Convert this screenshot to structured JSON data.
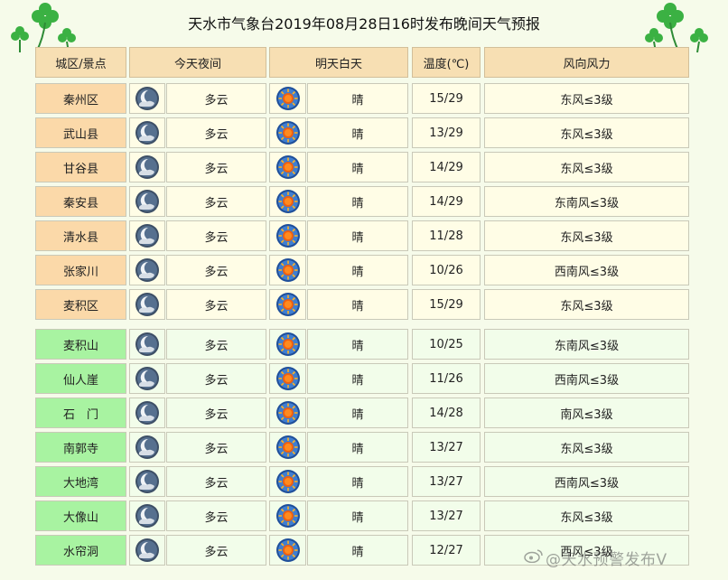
{
  "title": "天水市气象台2019年08月28日16时发布晚间天气预报",
  "headers": {
    "region": "城区/景点",
    "tonight": "今天夜间",
    "tomorrow": "明天白天",
    "temperature": "温度(℃)",
    "wind": "风向风力"
  },
  "icons": {
    "tonight": "cloudy-night-icon",
    "tomorrow": "sunny-icon"
  },
  "colors": {
    "header_bg": "#f7dfb3",
    "district_bg": "#fbd9a9",
    "scenic_bg": "#a8f3a1",
    "page_bg": "#f6fbea"
  },
  "rows": [
    {
      "name": "秦州区",
      "tonight": "多云",
      "tomorrow": "晴",
      "temp": "15/29",
      "wind": "东风≤3级",
      "group": "district"
    },
    {
      "name": "武山县",
      "tonight": "多云",
      "tomorrow": "晴",
      "temp": "13/29",
      "wind": "东风≤3级",
      "group": "district"
    },
    {
      "name": "甘谷县",
      "tonight": "多云",
      "tomorrow": "晴",
      "temp": "14/29",
      "wind": "东风≤3级",
      "group": "district"
    },
    {
      "name": "秦安县",
      "tonight": "多云",
      "tomorrow": "晴",
      "temp": "14/29",
      "wind": "东南风≤3级",
      "group": "district"
    },
    {
      "name": "清水县",
      "tonight": "多云",
      "tomorrow": "晴",
      "temp": "11/28",
      "wind": "东风≤3级",
      "group": "district"
    },
    {
      "name": "张家川",
      "tonight": "多云",
      "tomorrow": "晴",
      "temp": "10/26",
      "wind": "西南风≤3级",
      "group": "district"
    },
    {
      "name": "麦积区",
      "tonight": "多云",
      "tomorrow": "晴",
      "temp": "15/29",
      "wind": "东风≤3级",
      "group": "district"
    },
    {
      "name": "麦积山",
      "tonight": "多云",
      "tomorrow": "晴",
      "temp": "10/25",
      "wind": "东南风≤3级",
      "group": "scenic"
    },
    {
      "name": "仙人崖",
      "tonight": "多云",
      "tomorrow": "晴",
      "temp": "11/26",
      "wind": "西南风≤3级",
      "group": "scenic"
    },
    {
      "name": "石　门",
      "tonight": "多云",
      "tomorrow": "晴",
      "temp": "14/28",
      "wind": "南风≤3级",
      "group": "scenic"
    },
    {
      "name": "南郭寺",
      "tonight": "多云",
      "tomorrow": "晴",
      "temp": "13/27",
      "wind": "东风≤3级",
      "group": "scenic"
    },
    {
      "name": "大地湾",
      "tonight": "多云",
      "tomorrow": "晴",
      "temp": "13/27",
      "wind": "西南风≤3级",
      "group": "scenic"
    },
    {
      "name": "大像山",
      "tonight": "多云",
      "tomorrow": "晴",
      "temp": "13/27",
      "wind": "东风≤3级",
      "group": "scenic"
    },
    {
      "name": "水帘洞",
      "tonight": "多云",
      "tomorrow": "晴",
      "temp": "12/27",
      "wind": "西风≤3级",
      "group": "scenic"
    }
  ],
  "watermark": "@天水预警发布V"
}
